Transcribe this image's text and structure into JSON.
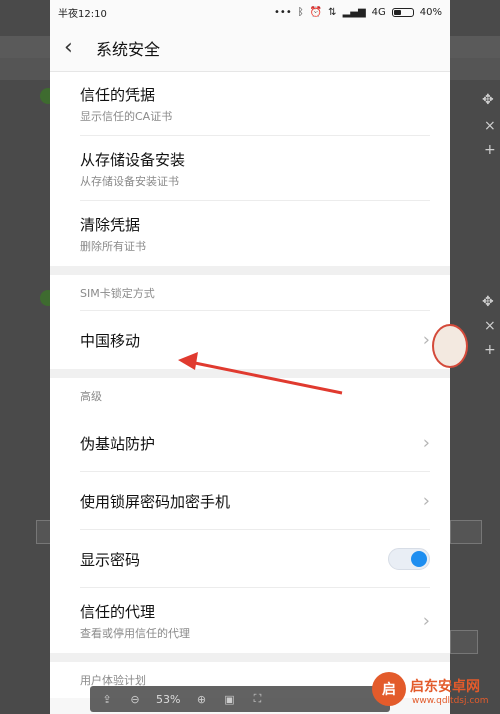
{
  "status_bar": {
    "time": "半夜12:10",
    "icons": [
      "more-icon",
      "bluetooth-icon",
      "alarm-icon",
      "data-icon",
      "signal-icon"
    ],
    "network": "4G",
    "battery": "40%",
    "battery_level": 0.4
  },
  "header": {
    "title": "系统安全"
  },
  "credentials": [
    {
      "title": "信任的凭据",
      "subtitle": "显示信任的CA证书"
    },
    {
      "title": "从存储设备安装",
      "subtitle": "从存储设备安装证书"
    },
    {
      "title": "清除凭据",
      "subtitle": "删除所有证书"
    }
  ],
  "sim_section": {
    "header": "SIM卡锁定方式",
    "item": "中国移动"
  },
  "advanced_section": {
    "header": "高级",
    "items": [
      {
        "title": "伪基站防护"
      },
      {
        "title": "使用锁屏密码加密手机"
      },
      {
        "title": "显示密码",
        "toggle": true
      },
      {
        "title": "信任的代理",
        "subtitle": "查看或停用信任的代理"
      }
    ]
  },
  "footer_item": "用户体验计划",
  "viewer_toolbar": {
    "zoom": "53%"
  },
  "watermark": {
    "title": "启东安卓网",
    "url": "www.qdltdsj.com"
  },
  "colors": {
    "accent": "#1e8ef0",
    "arrow": "#e03a2f"
  }
}
